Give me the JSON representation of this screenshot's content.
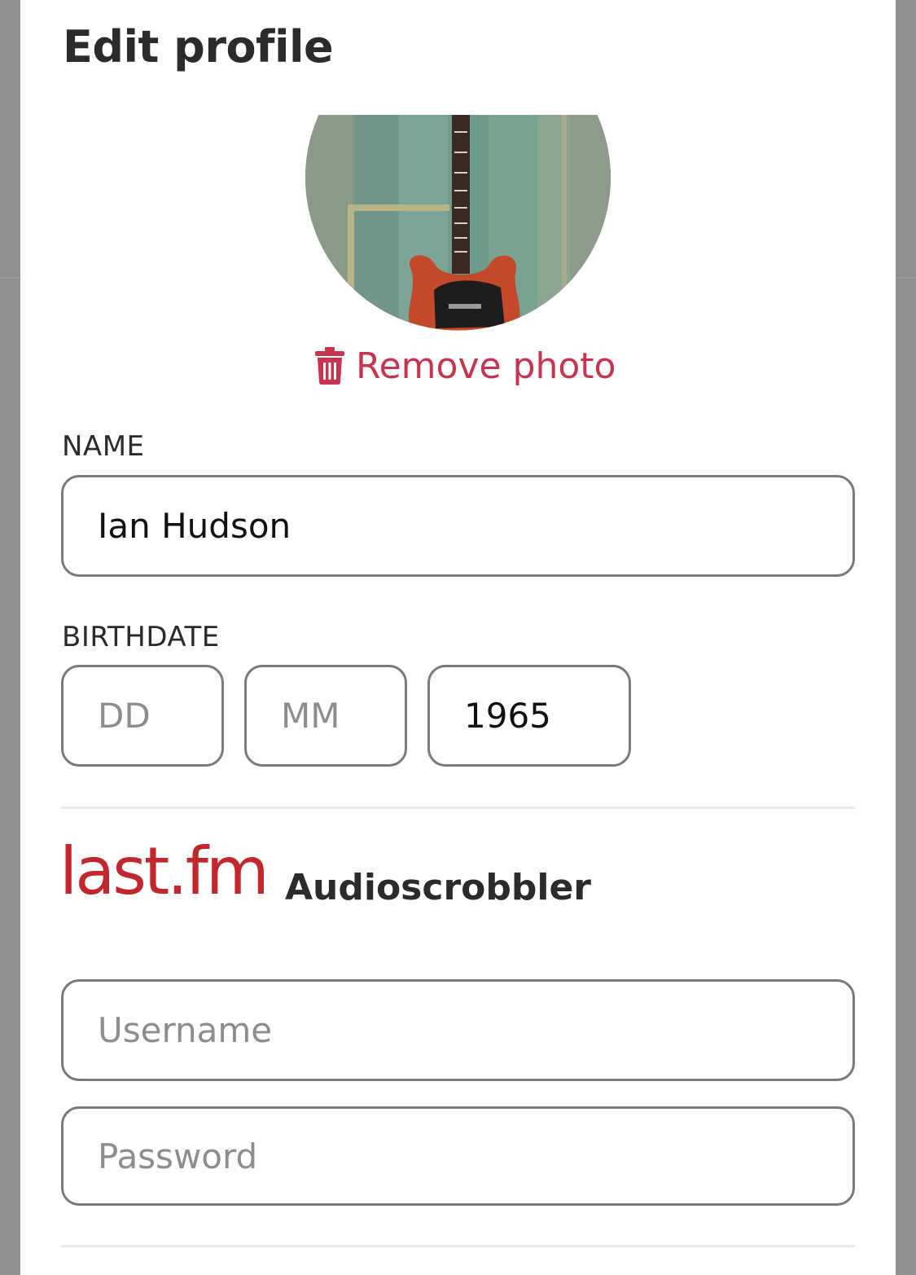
{
  "sheet": {
    "title": "Edit profile"
  },
  "avatar": {
    "remove_label": "Remove photo"
  },
  "name_field": {
    "label": "NAME",
    "value": "Ian Hudson"
  },
  "birthdate": {
    "label": "BIRTHDATE",
    "day_placeholder": "DD",
    "month_placeholder": "MM",
    "year_value": "1965"
  },
  "lastfm": {
    "logo": "last.fm",
    "label": "Audioscrobbler",
    "username_placeholder": "Username",
    "password_placeholder": "Password"
  },
  "colors": {
    "accent_remove": "#c8344f",
    "lastfm_red": "#c1272d"
  },
  "icons": {
    "remove": "trash-icon"
  }
}
